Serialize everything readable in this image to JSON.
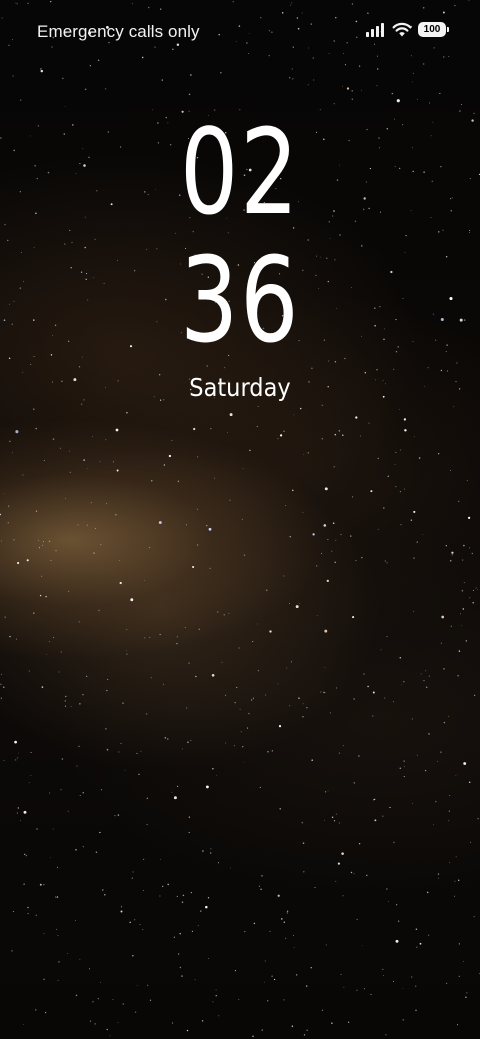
{
  "status_bar": {
    "carrier_text": "Emergency calls only",
    "battery_level": "100",
    "icons": [
      "signal-icon",
      "wifi-icon",
      "battery-icon"
    ]
  },
  "lock_clock": {
    "hours": "02",
    "minutes": "36",
    "day": "Saturday"
  },
  "wallpaper": {
    "subject": "starry-night-milky-way",
    "colors": [
      "#050505",
      "#a07a4e"
    ]
  }
}
